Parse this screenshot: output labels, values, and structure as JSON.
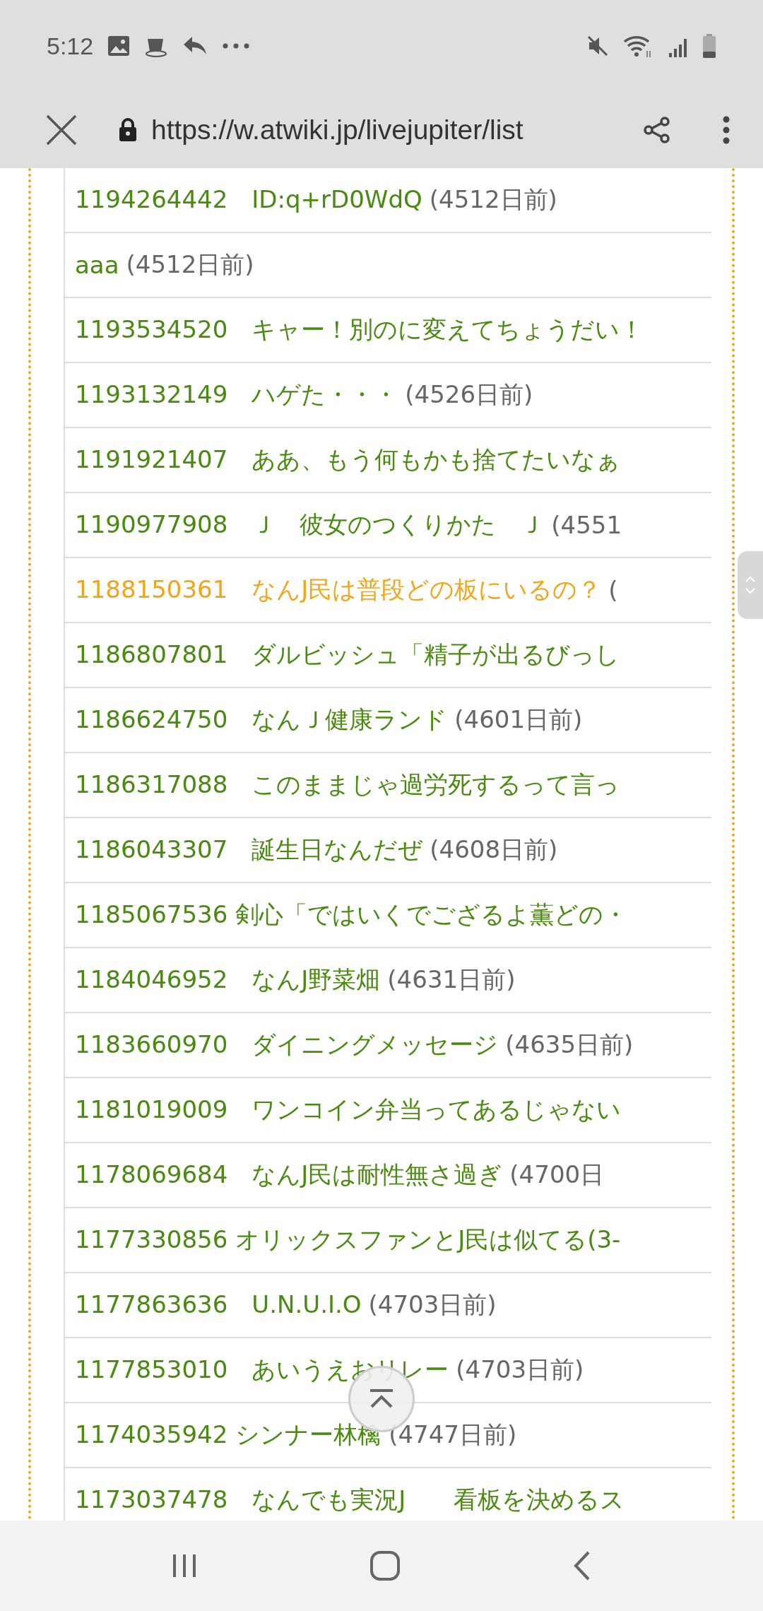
{
  "status_bar": {
    "time": "5:12"
  },
  "address_bar": {
    "url": "https://w.atwiki.jp/livejupiter/list"
  },
  "list": [
    {
      "text": "1194264442　ID:q+rD0WdQ",
      "date": "(4512日前)",
      "highlighted": false
    },
    {
      "text": "aaa",
      "date": "(4512日前)",
      "highlighted": false
    },
    {
      "text": "1193534520　キャー！別のに変えてちょうだい！",
      "highlighted": false
    },
    {
      "text": "1193132149　ハゲた・・・",
      "date": "(4526日前)",
      "highlighted": false
    },
    {
      "text": "1191921407　ああ、もう何もかも捨てたいなぁ",
      "highlighted": false
    },
    {
      "text": "1190977908　Ｊ　彼女のつくりかた　Ｊ",
      "date": "(4551",
      "highlighted": false
    },
    {
      "text": "1188150361　なんJ民は普段どの板にいるの？",
      "date": "(",
      "highlighted": true
    },
    {
      "text": "1186807801　ダルビッシュ「精子が出るびっし",
      "highlighted": false
    },
    {
      "text": "1186624750　なんＪ健康ランド",
      "date": "(4601日前)",
      "highlighted": false
    },
    {
      "text": "1186317088　このままじゃ過労死するって言っ",
      "highlighted": false
    },
    {
      "text": "1186043307　誕生日なんだぜ",
      "date": "(4608日前)",
      "highlighted": false
    },
    {
      "text": "1185067536 剣心「ではいくでござるよ薫どの・",
      "highlighted": false
    },
    {
      "text": "1184046952　なんJ野菜畑",
      "date": "(4631日前)",
      "highlighted": false
    },
    {
      "text": "1183660970　ダイニングメッセージ",
      "date": "(4635日前)",
      "highlighted": false
    },
    {
      "text": "1181019009　ワンコイン弁当ってあるじゃない",
      "highlighted": false
    },
    {
      "text": "1178069684　なんJ民は耐性無さ過ぎ",
      "date": "(4700日",
      "highlighted": false
    },
    {
      "text": "1177330856 オリックスファンとJ民は似てる(3-",
      "highlighted": false
    },
    {
      "text": "1177863636　U.N.U.I.O",
      "date": "(4703日前)",
      "highlighted": false
    },
    {
      "text": "1177853010　あいうえおリレー",
      "date": "(4703日前)",
      "highlighted": false
    },
    {
      "text": "1174035942 シンナー林檎",
      "date": "(4747日前)",
      "highlighted": false
    },
    {
      "text": "1173037478　なんでも実況J　　看板を決めるス",
      "highlighted": false
    }
  ]
}
